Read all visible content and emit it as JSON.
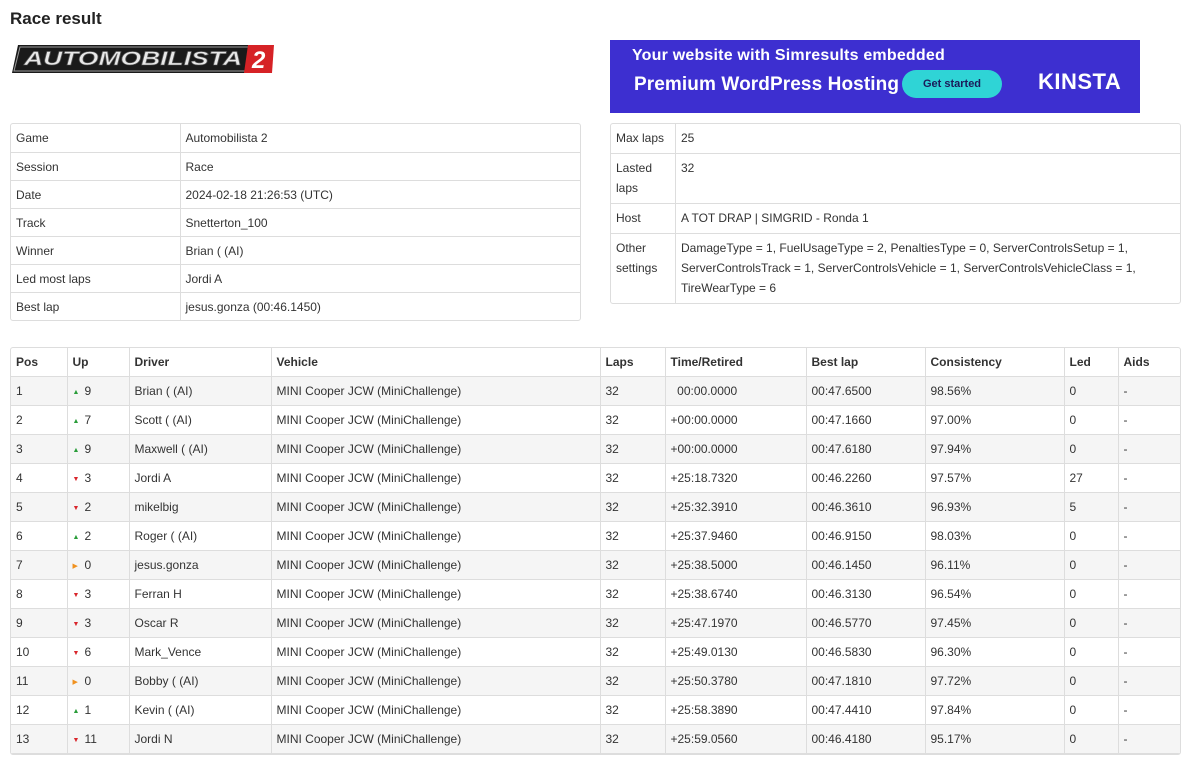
{
  "page": {
    "title": "Race result"
  },
  "logo": {
    "text": "AUTOMOBILISTA",
    "numeral": "2"
  },
  "ad": {
    "line1": "Your website with Simresults embedded",
    "line2": "Premium WordPress Hosting",
    "button": "Get started",
    "brand": "KINSTA"
  },
  "session_info": [
    {
      "key": "Game",
      "value": "Automobilista 2"
    },
    {
      "key": "Session",
      "value": "Race"
    },
    {
      "key": "Date",
      "value": "2024-02-18 21:26:53 (UTC)"
    },
    {
      "key": "Track",
      "value": "Snetterton_100"
    },
    {
      "key": "Winner",
      "value": "Brian ( (AI)"
    },
    {
      "key": "Led most laps",
      "value": "Jordi A"
    },
    {
      "key": "Best lap",
      "value": "jesus.gonza (00:46.1450)"
    }
  ],
  "server_info": [
    {
      "key": "Max laps",
      "value": "25"
    },
    {
      "key": "Lasted laps",
      "value": "32"
    },
    {
      "key": "Host",
      "value": "A TOT DRAP | SIMGRID - Ronda 1"
    },
    {
      "key": "Other settings",
      "value": "DamageType = 1, FuelUsageType = 2, PenaltiesType = 0, ServerControlsSetup = 1, ServerControlsTrack = 1, ServerControlsVehicle = 1, ServerControlsVehicleClass = 1, TireWearType = 6"
    }
  ],
  "results": {
    "columns": [
      "Pos",
      "Up",
      "Driver",
      "Vehicle",
      "Laps",
      "Time/Retired",
      "Best lap",
      "Consistency",
      "Led",
      "Aids"
    ],
    "rows": [
      {
        "pos": "1",
        "dir": "up",
        "up": "9",
        "driver": "Brian ( (AI)",
        "vehicle": "MINI Cooper JCW (MiniChallenge)",
        "laps": "32",
        "time": "  00:00.0000",
        "best": "00:47.6500",
        "consistency": "98.56%",
        "led": "0",
        "aids": "-"
      },
      {
        "pos": "2",
        "dir": "up",
        "up": "7",
        "driver": "Scott ( (AI)",
        "vehicle": "MINI Cooper JCW (MiniChallenge)",
        "laps": "32",
        "time": "+00:00.0000",
        "best": "00:47.1660",
        "consistency": "97.00%",
        "led": "0",
        "aids": "-"
      },
      {
        "pos": "3",
        "dir": "up",
        "up": "9",
        "driver": "Maxwell ( (AI)",
        "vehicle": "MINI Cooper JCW (MiniChallenge)",
        "laps": "32",
        "time": "+00:00.0000",
        "best": "00:47.6180",
        "consistency": "97.94%",
        "led": "0",
        "aids": "-"
      },
      {
        "pos": "4",
        "dir": "down",
        "up": "3",
        "driver": "Jordi A",
        "vehicle": "MINI Cooper JCW (MiniChallenge)",
        "laps": "32",
        "time": "+25:18.7320",
        "best": "00:46.2260",
        "consistency": "97.57%",
        "led": "27",
        "aids": "-"
      },
      {
        "pos": "5",
        "dir": "down",
        "up": "2",
        "driver": "mikelbig",
        "vehicle": "MINI Cooper JCW (MiniChallenge)",
        "laps": "32",
        "time": "+25:32.3910",
        "best": "00:46.3610",
        "consistency": "96.93%",
        "led": "5",
        "aids": "-"
      },
      {
        "pos": "6",
        "dir": "up",
        "up": "2",
        "driver": "Roger ( (AI)",
        "vehicle": "MINI Cooper JCW (MiniChallenge)",
        "laps": "32",
        "time": "+25:37.9460",
        "best": "00:46.9150",
        "consistency": "98.03%",
        "led": "0",
        "aids": "-"
      },
      {
        "pos": "7",
        "dir": "same",
        "up": "0",
        "driver": "jesus.gonza",
        "vehicle": "MINI Cooper JCW (MiniChallenge)",
        "laps": "32",
        "time": "+25:38.5000",
        "best": "00:46.1450",
        "consistency": "96.11%",
        "led": "0",
        "aids": "-"
      },
      {
        "pos": "8",
        "dir": "down",
        "up": "3",
        "driver": "Ferran H",
        "vehicle": "MINI Cooper JCW (MiniChallenge)",
        "laps": "32",
        "time": "+25:38.6740",
        "best": "00:46.3130",
        "consistency": "96.54%",
        "led": "0",
        "aids": "-"
      },
      {
        "pos": "9",
        "dir": "down",
        "up": "3",
        "driver": "Oscar R",
        "vehicle": "MINI Cooper JCW (MiniChallenge)",
        "laps": "32",
        "time": "+25:47.1970",
        "best": "00:46.5770",
        "consistency": "97.45%",
        "led": "0",
        "aids": "-"
      },
      {
        "pos": "10",
        "dir": "down",
        "up": "6",
        "driver": "Mark_Vence",
        "vehicle": "MINI Cooper JCW (MiniChallenge)",
        "laps": "32",
        "time": "+25:49.0130",
        "best": "00:46.5830",
        "consistency": "96.30%",
        "led": "0",
        "aids": "-"
      },
      {
        "pos": "11",
        "dir": "same",
        "up": "0",
        "driver": "Bobby ( (AI)",
        "vehicle": "MINI Cooper JCW (MiniChallenge)",
        "laps": "32",
        "time": "+25:50.3780",
        "best": "00:47.1810",
        "consistency": "97.72%",
        "led": "0",
        "aids": "-"
      },
      {
        "pos": "12",
        "dir": "up",
        "up": "1",
        "driver": "Kevin ( (AI)",
        "vehicle": "MINI Cooper JCW (MiniChallenge)",
        "laps": "32",
        "time": "+25:58.3890",
        "best": "00:47.4410",
        "consistency": "97.84%",
        "led": "0",
        "aids": "-"
      },
      {
        "pos": "13",
        "dir": "down",
        "up": "11",
        "driver": "Jordi N",
        "vehicle": "MINI Cooper JCW (MiniChallenge)",
        "laps": "32",
        "time": "+25:59.0560",
        "best": "00:46.4180",
        "consistency": "95.17%",
        "led": "0",
        "aids": "-"
      }
    ]
  },
  "icons": {
    "up": "triangle-up-icon",
    "down": "triangle-down-icon",
    "same": "triangle-right-icon"
  },
  "colors": {
    "up": "#2a9d3a",
    "down": "#d9262c",
    "same": "#f0911f",
    "ad_bg": "#3d2fd0",
    "ad_button": "#2fd4d6"
  }
}
